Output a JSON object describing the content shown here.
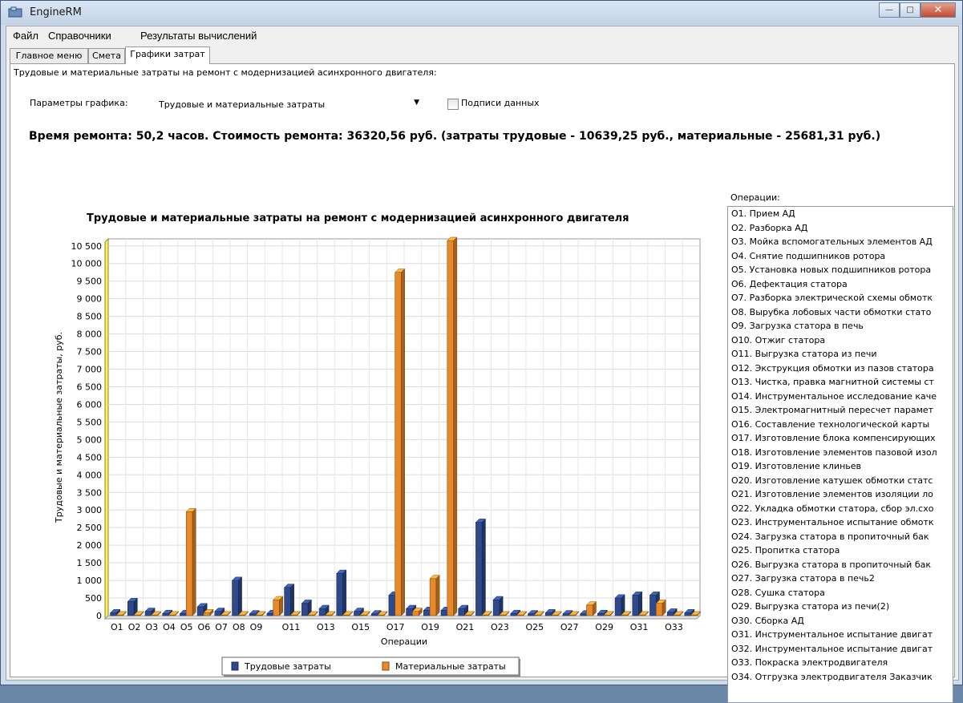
{
  "window": {
    "title": "EngineRM"
  },
  "menu": [
    "Файл",
    "Справочники",
    "Результаты вычислений"
  ],
  "tabs": [
    "Главное меню",
    "Смета",
    "Графики затрат"
  ],
  "header_text": "Трудовые и материальные затраты на ремонт с модернизацией асинхронного двигателя:",
  "params": {
    "label": "Параметры графика:",
    "selected": "Трудовые и материальные затраты",
    "checkbox_label": "Подписи данных"
  },
  "summary": "Время ремонта: 50,2 часов. Стоимость ремонта: 36320,56 руб. (затраты трудовые - 10639,25 руб., материальные - 25681,31 руб.)",
  "operations_label": "Операции:",
  "operations": [
    "О1. Прием АД",
    "О2. Разборка АД",
    "О3. Мойка вспомогательных элементов АД",
    "О4. Снятие подшипников ротора",
    "О5. Установка новых подшипников ротора",
    "О6. Дефектация статора",
    "О7. Разборка электрической схемы обмотк",
    "О8. Вырубка лобовых части обмотки стато",
    "О9. Загрузка статора в печь",
    "О10. Отжиг статора",
    "О11. Выгрузка статора из печи",
    "О12. Экструкция обмотки из пазов статора",
    "О13. Чистка, правка магнитной системы ст",
    "О14. Инструментальное исследование каче",
    "О15. Электромагнитный пересчет парамет",
    "О16. Составление технологической карты",
    "О17. Изготовление блока компенсирующих",
    "О18. Изготовление элементов пазовой изол",
    "О19. Изготовление клиньев",
    "О20. Изготовление катушек обмотки статс",
    "О21. Изготовление элементов изоляции ло",
    "О22. Укладка обмотки статора, сбор эл.схо",
    "О23. Инструментальное испытание обмотк",
    "О24. Загрузка статора в пропиточный бак",
    "О25. Пропитка статора",
    "О26. Выгрузка статора в пропиточный бак",
    "О27. Загрузка статора в печь2",
    "О28. Сушка статора",
    "О29. Выгрузка статора из печи(2)",
    "О30. Сборка АД",
    "О31. Инструментальное испытание двигат",
    "О32. Инструментальное испытание двигат",
    "О33. Покраска электродвигателя",
    "О34. Отгрузка электродвигателя Заказчик"
  ],
  "chart_data": {
    "type": "bar",
    "title": "Трудовые и материальные затраты на ремонт с модернизацией асинхронного двигателя",
    "xlabel": "Операции",
    "ylabel": "Трудовые и материальные затраты, руб.",
    "ylim": [
      0,
      10700
    ],
    "grid": true,
    "legend_position": "bottom",
    "categories": [
      "O1",
      "O2",
      "O3",
      "O4",
      "O5",
      "O6",
      "O7",
      "O8",
      "O9",
      "O10",
      "O11",
      "O12",
      "O13",
      "O14",
      "O15",
      "O16",
      "O17",
      "O18",
      "O19",
      "O20",
      "O21",
      "O22",
      "O23",
      "O24",
      "O25",
      "O26",
      "O27",
      "O28",
      "O29",
      "O30",
      "O31",
      "O32",
      "O33",
      "O34"
    ],
    "tick_labels": [
      "O1",
      "O2",
      "O3",
      "O4",
      "O5",
      "O6",
      "O7",
      "O8",
      "O9",
      "",
      "O11",
      "",
      "O13",
      "",
      "O15",
      "",
      "O17",
      "",
      "O19",
      "",
      "O21",
      "",
      "O23",
      "",
      "O25",
      "",
      "O27",
      "",
      "O29",
      "",
      "O31",
      "",
      "O33",
      ""
    ],
    "yticks": [
      "0",
      "500",
      "1 000",
      "1 500",
      "2 000",
      "2 500",
      "3 000",
      "3 500",
      "4 000",
      "4 500",
      "5 000",
      "5 500",
      "6 000",
      "6 500",
      "7 000",
      "7 500",
      "8 000",
      "8 500",
      "9 000",
      "9 500",
      "10 000",
      "10 500"
    ],
    "series": [
      {
        "name": "Трудовые затраты",
        "color": "#2e4a8c",
        "values": [
          80,
          400,
          120,
          60,
          60,
          250,
          120,
          1000,
          50,
          60,
          800,
          350,
          200,
          1200,
          120,
          50,
          580,
          200,
          150,
          150,
          200,
          2650,
          450,
          60,
          50,
          80,
          50,
          50,
          60,
          500,
          580,
          580,
          100,
          80
        ]
      },
      {
        "name": "Материальные затраты",
        "color": "#e8892a",
        "values": [
          20,
          20,
          20,
          20,
          2950,
          80,
          20,
          20,
          20,
          450,
          20,
          20,
          20,
          20,
          20,
          20,
          9750,
          120,
          1050,
          10650,
          20,
          20,
          20,
          20,
          20,
          20,
          20,
          300,
          20,
          20,
          20,
          350,
          20,
          20
        ]
      }
    ]
  }
}
